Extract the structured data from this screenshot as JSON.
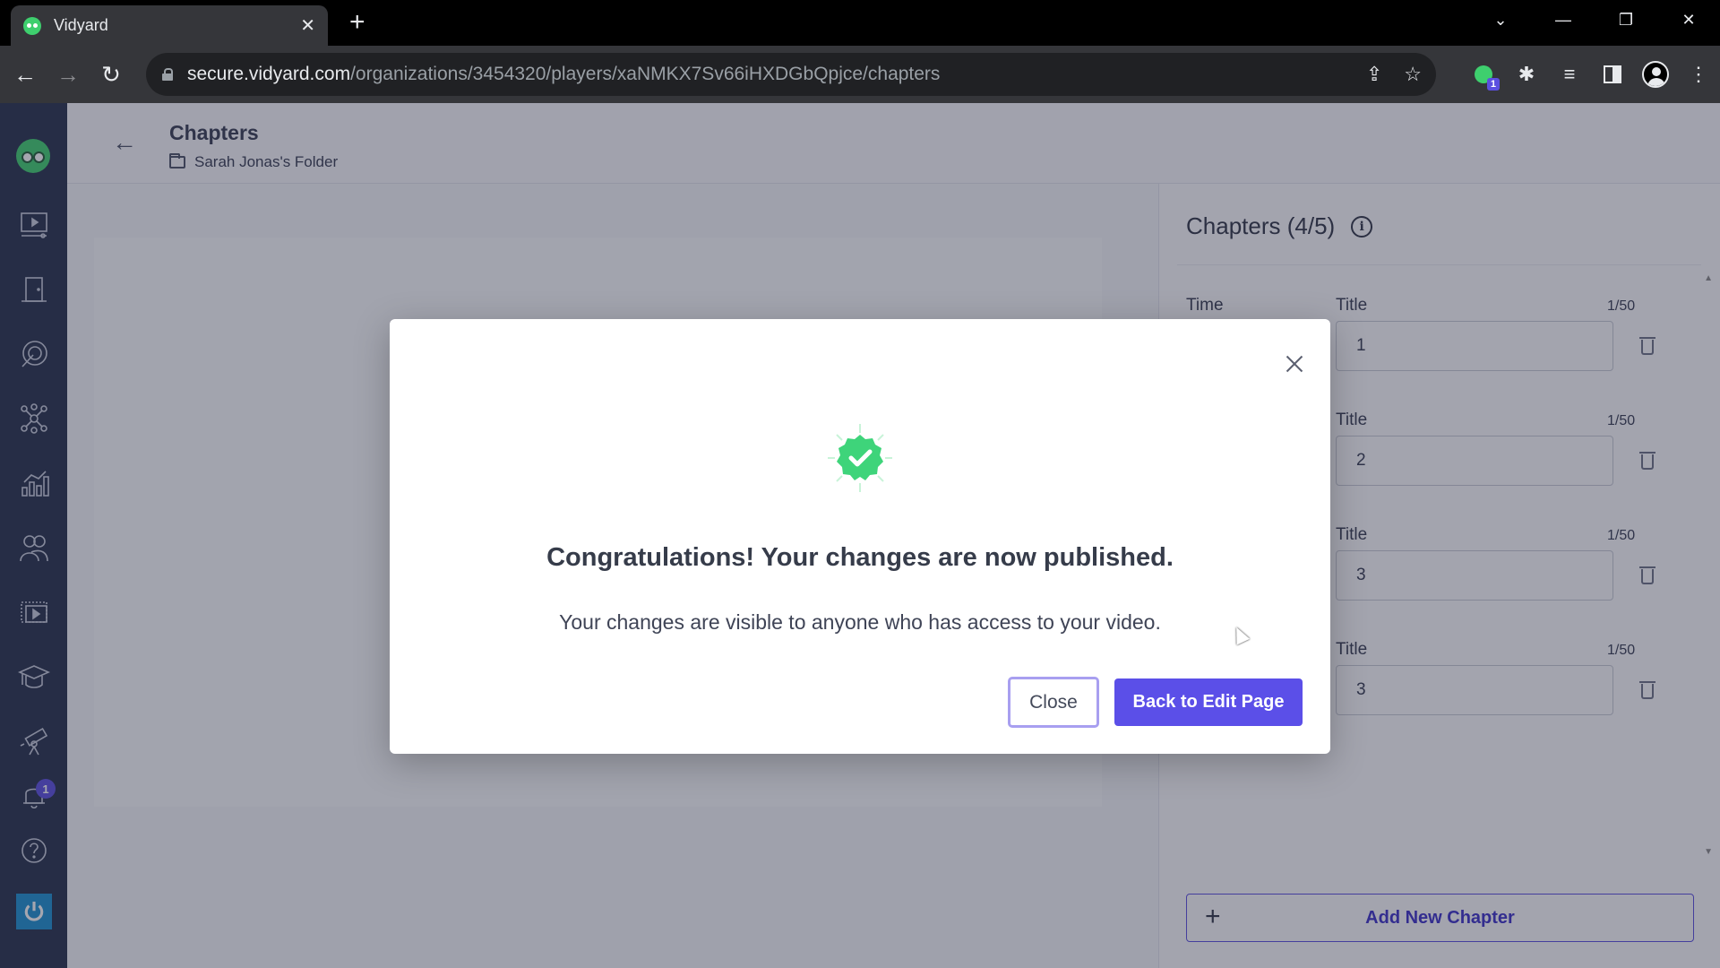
{
  "browser": {
    "tab_title": "Vidyard",
    "url_host": "secure.vidyard.com",
    "url_path": "/organizations/3454320/players/xaNMKX7Sv66iHXDGbQpjce/chapters",
    "extension_badge": "1",
    "icons": [
      "back-icon",
      "forward-icon",
      "reload-icon",
      "lock-icon",
      "share-icon",
      "star-icon",
      "vidyard-extension-icon",
      "extensions-puzzle-icon",
      "media-queue-icon",
      "side-panel-icon",
      "profile-icon",
      "menu-kebab-icon",
      "minimize-icon",
      "restore-icon",
      "window-close-icon",
      "tab-search-icon"
    ]
  },
  "sidebar": {
    "items": [
      {
        "name": "videos",
        "icon": "video-library-icon"
      },
      {
        "name": "hubs",
        "icon": "door-icon"
      },
      {
        "name": "engagement",
        "icon": "target-icon"
      },
      {
        "name": "integrations",
        "icon": "network-icon"
      },
      {
        "name": "analytics",
        "icon": "analytics-icon"
      },
      {
        "name": "contacts",
        "icon": "people-icon"
      },
      {
        "name": "playlists",
        "icon": "playlist-icon"
      },
      {
        "name": "learning",
        "icon": "graduation-cap-icon"
      },
      {
        "name": "discover",
        "icon": "telescope-icon"
      },
      {
        "name": "notifications",
        "icon": "bell-icon",
        "badge": "1"
      },
      {
        "name": "help",
        "icon": "help-icon"
      },
      {
        "name": "power",
        "icon": "power-icon"
      }
    ]
  },
  "header": {
    "title": "Chapters",
    "folder": "Sarah Jonas's Folder"
  },
  "chapters_panel": {
    "title": "Chapters (4/5)",
    "time_label": "Time",
    "title_label": "Title",
    "chapters": [
      {
        "title": "1",
        "count": "1/50"
      },
      {
        "title": "2",
        "count": "1/50"
      },
      {
        "title": "3",
        "count": "1/50"
      },
      {
        "title": "3",
        "count": "1/50"
      }
    ],
    "add_button": "Add New Chapter"
  },
  "modal": {
    "heading": "Congratulations! Your changes are now published.",
    "body": "Your changes are visible to anyone who has access to your video.",
    "close_label": "Close",
    "primary_label": "Back to Edit Page",
    "accent_color": "#5b4fe8",
    "success_color": "#3ed47a"
  }
}
